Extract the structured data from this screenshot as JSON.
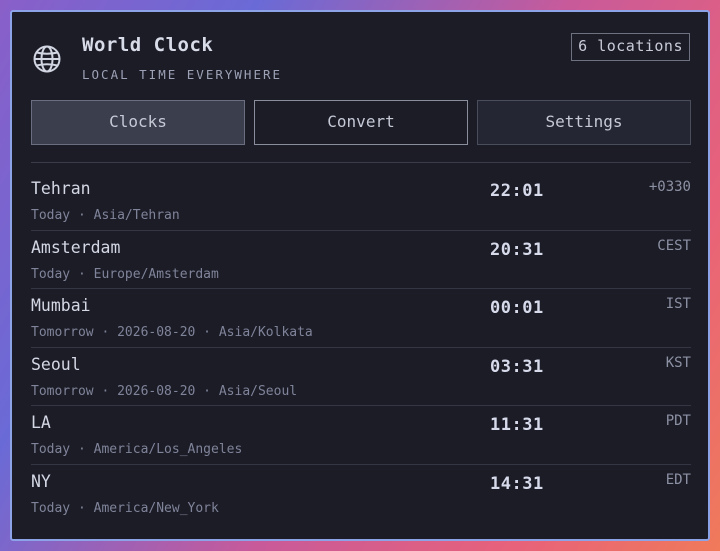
{
  "header": {
    "title": "World Clock",
    "subtitle": "LOCAL TIME EVERYWHERE",
    "badge": "6 locations",
    "icon": "globe-icon"
  },
  "tabs": [
    {
      "label": "Clocks",
      "state": "active"
    },
    {
      "label": "Convert",
      "state": "outlined"
    },
    {
      "label": "Settings",
      "state": "default"
    }
  ],
  "clocks": [
    {
      "city": "Tehran",
      "meta": "Today · Asia/Tehran",
      "time": "22:01",
      "tz": "+0330"
    },
    {
      "city": "Amsterdam",
      "meta": "Today · Europe/Amsterdam",
      "time": "20:31",
      "tz": "CEST"
    },
    {
      "city": "Mumbai",
      "meta": "Tomorrow · 2026-08-20 · Asia/Kolkata",
      "time": "00:01",
      "tz": "IST"
    },
    {
      "city": "Seoul",
      "meta": "Tomorrow · 2026-08-20 · Asia/Seoul",
      "time": "03:31",
      "tz": "KST"
    },
    {
      "city": "LA",
      "meta": "Today · America/Los_Angeles",
      "time": "11:31",
      "tz": "PDT"
    },
    {
      "city": "NY",
      "meta": "Today · America/New_York",
      "time": "14:31",
      "tz": "EDT"
    }
  ],
  "colors": {
    "panel": "#1b1c26",
    "border": "#8da3e8",
    "text": "#d4d7e4",
    "muted": "#80849a"
  }
}
